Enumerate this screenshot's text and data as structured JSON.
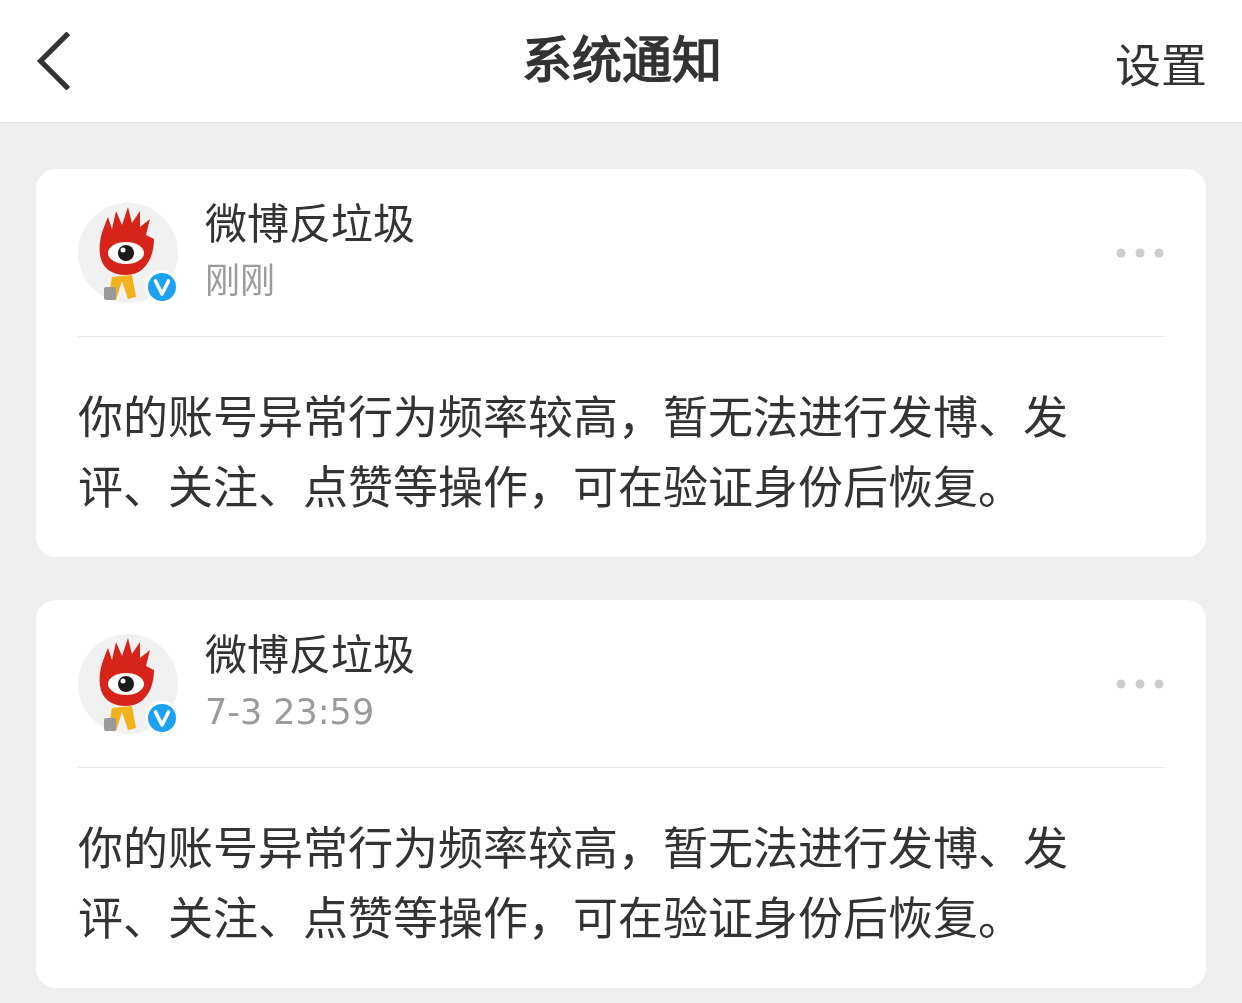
{
  "header": {
    "title": "系统通知",
    "action": "设置"
  },
  "notifications": [
    {
      "sender": "微博反垃圾",
      "verified": true,
      "time": "刚刚",
      "message": "你的账号异常行为频率较高，暂无法进行发博、发评、关注、点赞等操作，可在验证身份后恢复。"
    },
    {
      "sender": "微博反垃圾",
      "verified": true,
      "time": "7-3 23:59",
      "message": "你的账号异常行为频率较高，暂无法进行发博、发评、关注、点赞等操作，可在验证身份后恢复。"
    }
  ]
}
